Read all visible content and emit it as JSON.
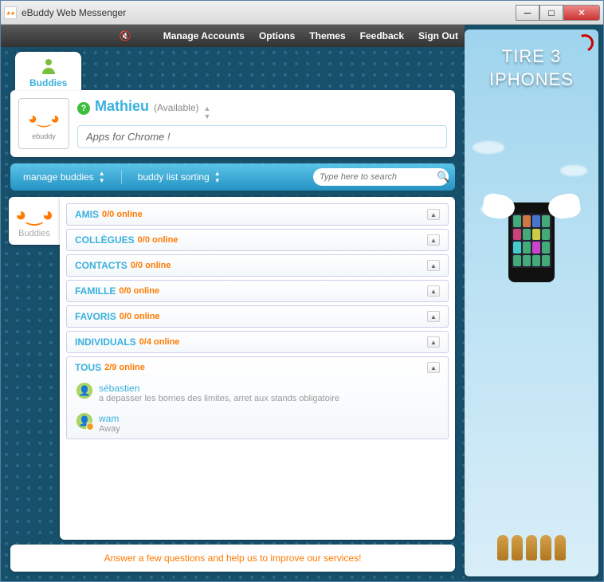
{
  "window": {
    "title": "eBuddy Web Messenger"
  },
  "topbar": {
    "manage_accounts": "Manage Accounts",
    "options": "Options",
    "themes": "Themes",
    "feedback": "Feedback",
    "signout": "Sign Out"
  },
  "tab": {
    "label": "Buddies"
  },
  "profile": {
    "brand": "ebuddy",
    "name": "Mathieu",
    "status_label": "(Available)",
    "status_input": "Apps for Chrome !"
  },
  "toolbar": {
    "manage_buddies": "manage buddies",
    "sorting": "buddy list sorting",
    "search_placeholder": "Type here to search"
  },
  "side_tab": {
    "label": "Buddies"
  },
  "groups": [
    {
      "name": "AMIS",
      "count": "0/0 online",
      "expanded": false
    },
    {
      "name": "COLLÈGUES",
      "count": "0/0 online",
      "expanded": false
    },
    {
      "name": "CONTACTS",
      "count": "0/0 online",
      "expanded": false
    },
    {
      "name": "FAMILLE",
      "count": "0/0 online",
      "expanded": false
    },
    {
      "name": "FAVORIS",
      "count": "0/0 online",
      "expanded": false
    },
    {
      "name": "INDIVIDUALS",
      "count": "0/4 online",
      "expanded": false
    },
    {
      "name": "TOUS",
      "count": "2/9 online",
      "expanded": true
    }
  ],
  "buddies": [
    {
      "name": "sébastien",
      "sub": "a depasser les bornes des limites, arret aux stands obligatoire",
      "presence": "online"
    },
    {
      "name": "wam",
      "sub": "Away",
      "presence": "away"
    }
  ],
  "footer": {
    "text": "Answer a few questions and help us to improve our services!"
  },
  "ad": {
    "line1": "TIRE 3",
    "line2": "IPHONES"
  },
  "colors": {
    "accent": "#39b0dd",
    "orange": "#ff7a00",
    "bg": "#17506b"
  }
}
